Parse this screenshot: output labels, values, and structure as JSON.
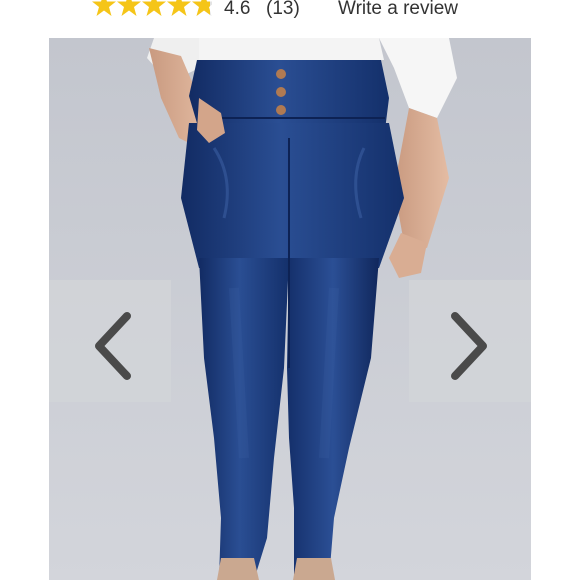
{
  "rating": {
    "stars_value": 4.6,
    "stars_max": 5,
    "star_color": "#f5c518",
    "value_text": "4.6",
    "count_text": "(13)",
    "write_review_label": "Write a review"
  },
  "gallery": {
    "image_subject": "dark wash high-waisted skinny jeans",
    "background_color": "#c9ccd3",
    "prev_icon": "chevron-left-icon",
    "next_icon": "chevron-right-icon"
  }
}
